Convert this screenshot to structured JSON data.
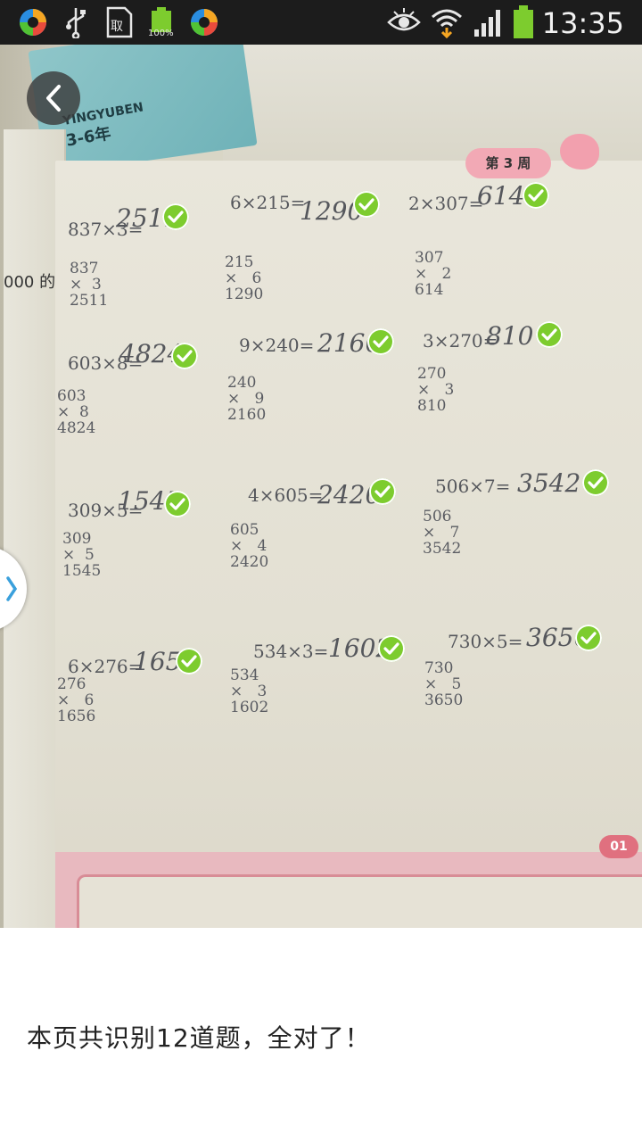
{
  "status_bar": {
    "time": "13:35",
    "battery_percent": "100%",
    "icons": [
      "app-icon",
      "usb-icon",
      "clipboard-icon",
      "battery-small-icon",
      "app-icon",
      "eye-icon",
      "wifi-icon",
      "signal-icon",
      "battery-icon"
    ]
  },
  "photo": {
    "book_text": "YINGYUBEN",
    "book_text2": "3-6年",
    "week_tag": "第 3 周",
    "side_text": "000 的",
    "page_number": "01"
  },
  "problems": [
    {
      "eq": "837×3=",
      "ans": "2511",
      "work": "837\n×  3\n2511"
    },
    {
      "eq": "6×215=",
      "ans": "1290",
      "work": "215\n×   6\n1290"
    },
    {
      "eq": "2×307=",
      "ans": "614",
      "work": "307\n×   2\n614"
    },
    {
      "eq": "603×8=",
      "ans": "4824",
      "work": "603\n×  8\n4824"
    },
    {
      "eq": "9×240=",
      "ans": "2160",
      "work": "240\n×   9\n2160"
    },
    {
      "eq": "3×270=",
      "ans": "810",
      "work": "270\n×   3\n810"
    },
    {
      "eq": "309×5=",
      "ans": "1545",
      "work": "309\n×  5\n1545"
    },
    {
      "eq": "4×605=",
      "ans": "2420",
      "work": "605\n×   4\n2420"
    },
    {
      "eq": "506×7=",
      "ans": "3542",
      "work": "506\n×   7\n3542"
    },
    {
      "eq": "6×276=",
      "ans": "1656",
      "work": "276\n×   6\n1656"
    },
    {
      "eq": "534×3=",
      "ans": "1602",
      "work": "534\n×   3\n1602"
    },
    {
      "eq": "730×5=",
      "ans": "3650",
      "work": "730\n×   5\n3650"
    }
  ],
  "result": {
    "text": "本页共识别12道题，全对了！",
    "total_problems": 12,
    "correct": 12
  },
  "colors": {
    "check_green": "#7dcc2e",
    "status_bar_bg": "#1c1c1c",
    "page_pink": "#e8b9bf"
  }
}
